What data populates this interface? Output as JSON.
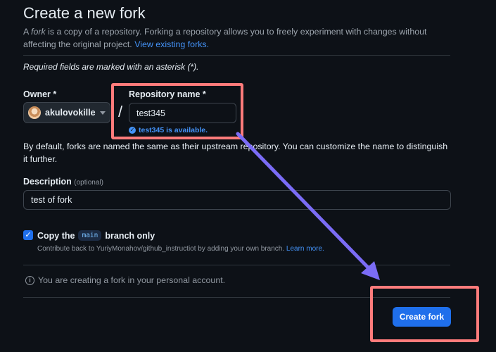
{
  "page": {
    "title": "Create a new fork",
    "intro_prefix": "A ",
    "intro_fork_word": "fork",
    "intro_text": " is a copy of a repository. Forking a repository allows you to freely experiment with changes without affecting the original project. ",
    "view_forks_link": "View existing forks."
  },
  "form": {
    "required_note": "Required fields are marked with an asterisk (*).",
    "owner": {
      "label": "Owner *",
      "value": "akulovokille"
    },
    "separator": "/",
    "repo_name": {
      "label": "Repository name *",
      "value": "test345",
      "availability": "test345 is available."
    },
    "helper_text": "By default, forks are named the same as their upstream repository. You can customize the name to distinguish it further.",
    "description": {
      "label": "Description",
      "optional": "(optional)",
      "value": "test of fork"
    },
    "copy_branch": {
      "checked": true,
      "label_prefix": "Copy the",
      "branch": "main",
      "label_suffix": "branch only",
      "contribute_text": "Contribute back to YuriyMonahov/github_instructiot by adding your own branch.",
      "learn_more": "Learn more."
    },
    "personal_note": "You are creating a fork in your personal account.",
    "submit_label": "Create fork"
  },
  "icons": {
    "check": "✓",
    "info": "i"
  },
  "colors": {
    "background": "#0d1117",
    "accent": "#1f6feb",
    "link": "#4493f8",
    "highlight": "#ff7b7b",
    "annotation_arrow": "#7b6cf6"
  }
}
